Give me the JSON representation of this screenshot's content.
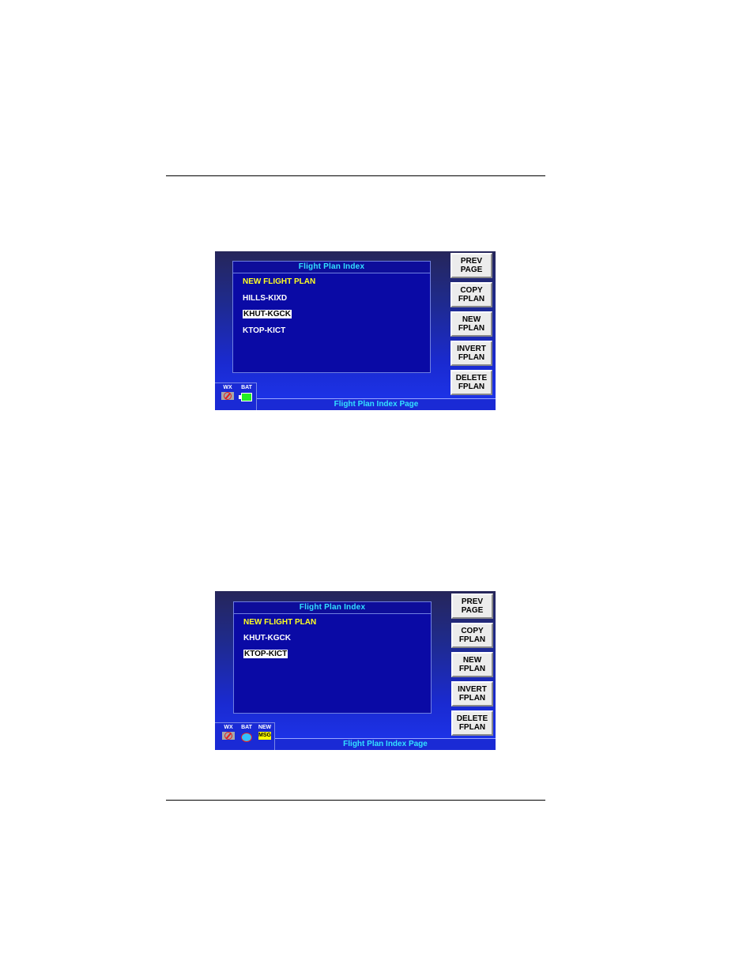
{
  "screens": [
    {
      "panel_title": "Flight Plan Index",
      "items": [
        {
          "label": "NEW FLIGHT PLAN",
          "type": "new"
        },
        {
          "label": "HILLS-KIXD",
          "type": "normal"
        },
        {
          "label": "KHUT-KGCK",
          "type": "selected"
        },
        {
          "label": "KTOP-KICT",
          "type": "normal"
        }
      ],
      "buttons": [
        {
          "line1": "PREV",
          "line2": "PAGE"
        },
        {
          "line1": "COPY",
          "line2": "FPLAN"
        },
        {
          "line1": "NEW",
          "line2": "FPLAN"
        },
        {
          "line1": "INVERT",
          "line2": "FPLAN"
        },
        {
          "line1": "DELETE",
          "line2": "FPLAN"
        }
      ],
      "indicators": {
        "wx": "WX",
        "bat": "BAT"
      },
      "status_text": "Flight Plan Index Page"
    },
    {
      "panel_title": "Flight Plan Index",
      "items": [
        {
          "label": "NEW FLIGHT PLAN",
          "type": "new"
        },
        {
          "label": "KHUT-KGCK",
          "type": "normal"
        },
        {
          "label": "KTOP-KICT",
          "type": "selected"
        }
      ],
      "buttons": [
        {
          "line1": "PREV",
          "line2": "PAGE"
        },
        {
          "line1": "COPY",
          "line2": "FPLAN"
        },
        {
          "line1": "NEW",
          "line2": "FPLAN"
        },
        {
          "line1": "INVERT",
          "line2": "FPLAN"
        },
        {
          "line1": "DELETE",
          "line2": "FPLAN"
        }
      ],
      "indicators": {
        "wx": "WX",
        "bat": "BAT",
        "new": "NEW",
        "msg": "MSG"
      },
      "status_text": "Flight Plan Index Page"
    }
  ]
}
